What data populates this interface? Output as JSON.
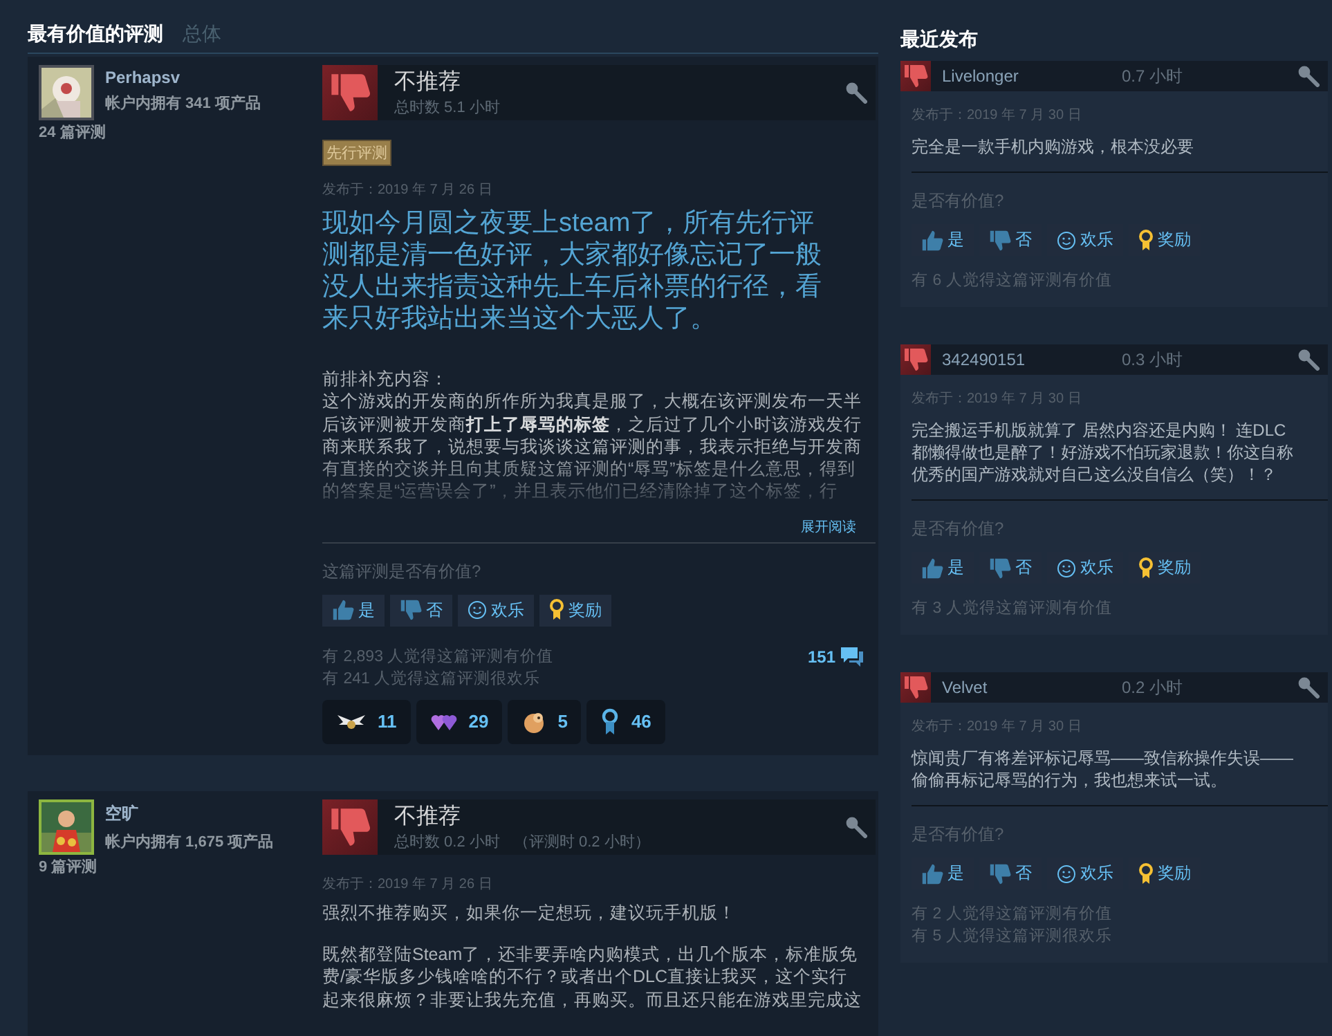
{
  "tabs": [
    {
      "label": "最有价值的评测",
      "selected": true
    },
    {
      "label": "总体",
      "selected": false
    }
  ],
  "reviews": [
    {
      "author": {
        "name": "Perhapsv",
        "products": "帐户内拥有 341 项产品",
        "review_count": "24 篇评测"
      },
      "recommended": false,
      "verdict": "不推荐",
      "hours": "总时数 5.1 小时",
      "tag": "先行评测",
      "posted": "发布于：2019 年 7 月 26 日",
      "headline": "现如今月圆之夜要上steam了，所有先行评测都是清一色好评，大家都好像忘记了一般没人出来指责这种先上车后补票的行径，看来只好我站出来当这个大恶人了。",
      "body": [
        "前排补充内容：",
        "这个游戏的开发商的所作所为我真是服了，大概在该评测发布一天半后该评测被开发商**打上了辱骂的标签**，之后过了几个小时该游戏发行商来联系我了，说想要与我谈谈这篇评测的事，我表示拒绝与开发商有直接的交谈并且向其质疑这篇评测的“辱骂”标签是什么意思，得到的答案是“运营误会了”，并且表示他们已经清除掉了这个标签，行"
      ],
      "read_more": "展开阅读",
      "question": "这篇评测是否有价值?",
      "votes": [
        {
          "kind": "yes",
          "label": "是"
        },
        {
          "kind": "no",
          "label": "否"
        },
        {
          "kind": "funny",
          "label": "欢乐"
        },
        {
          "kind": "award",
          "label": "奖励"
        }
      ],
      "counts": [
        "有 2,893 人觉得这篇评测有价值",
        "有 241 人觉得这篇评测很欢乐"
      ],
      "comments": "151",
      "awards": [
        {
          "kind": "wings",
          "count": "11"
        },
        {
          "kind": "hearts",
          "count": "29"
        },
        {
          "kind": "critter",
          "count": "5"
        },
        {
          "kind": "ribbon",
          "count": "46"
        }
      ]
    },
    {
      "author": {
        "name": "空旷",
        "products": "帐户内拥有 1,675 项产品",
        "review_count": "9 篇评测"
      },
      "recommended": false,
      "verdict": "不推荐",
      "hours": "总时数 0.2 小时",
      "hours_at_review": "（评测时 0.2 小时）",
      "posted": "发布于：2019 年 7 月 26 日",
      "body": [
        "强烈不推荐购买，如果你一定想玩，建议玩手机版！",
        "既然都登陆Steam了，还非要弄啥内购模式，出几个版本，标准版免费/豪华版多少钱啥啥的不行？或者出个DLC直接让我买，这个实行起来很麻烦？非要让我先充值，再购买。而且还只能在游戏里完成这"
      ]
    }
  ],
  "recent": {
    "title": "最近发布",
    "items": [
      {
        "name": "Livelonger",
        "recommended": false,
        "hours": "0.7 小时",
        "posted": "发布于：2019 年 7 月 30 日",
        "text": "完全是一款手机内购游戏，根本没必要",
        "question": "是否有价值?",
        "votes": [
          {
            "kind": "yes",
            "label": "是"
          },
          {
            "kind": "no",
            "label": "否"
          },
          {
            "kind": "funny",
            "label": "欢乐"
          },
          {
            "kind": "award",
            "label": "奖励"
          }
        ],
        "counts": [
          "有 6 人觉得这篇评测有价值"
        ]
      },
      {
        "name": "342490151",
        "recommended": false,
        "hours": "0.3 小时",
        "posted": "发布于：2019 年 7 月 30 日",
        "text": "完全搬运手机版就算了 居然内容还是内购！ 连DLC都懒得做也是醉了！好游戏不怕玩家退款！你这自称优秀的国产游戏就对自己这么没自信么（笑）！？",
        "question": "是否有价值?",
        "votes": [
          {
            "kind": "yes",
            "label": "是"
          },
          {
            "kind": "no",
            "label": "否"
          },
          {
            "kind": "funny",
            "label": "欢乐"
          },
          {
            "kind": "award",
            "label": "奖励"
          }
        ],
        "counts": [
          "有 3 人觉得这篇评测有价值"
        ]
      },
      {
        "name": "Velvet",
        "recommended": false,
        "hours": "0.2 小时",
        "posted": "发布于：2019 年 7 月 30 日",
        "text": "惊闻贵厂有将差评标记辱骂——致信称操作失误——偷偷再标记辱骂的行为，我也想来试一试。",
        "question": "是否有价值?",
        "votes": [
          {
            "kind": "yes",
            "label": "是"
          },
          {
            "kind": "no",
            "label": "否"
          },
          {
            "kind": "funny",
            "label": "欢乐"
          },
          {
            "kind": "award",
            "label": "奖励"
          }
        ],
        "counts": [
          "有 2 人觉得这篇评测有价值",
          "有 5 人觉得这篇评测很欢乐"
        ]
      }
    ]
  }
}
